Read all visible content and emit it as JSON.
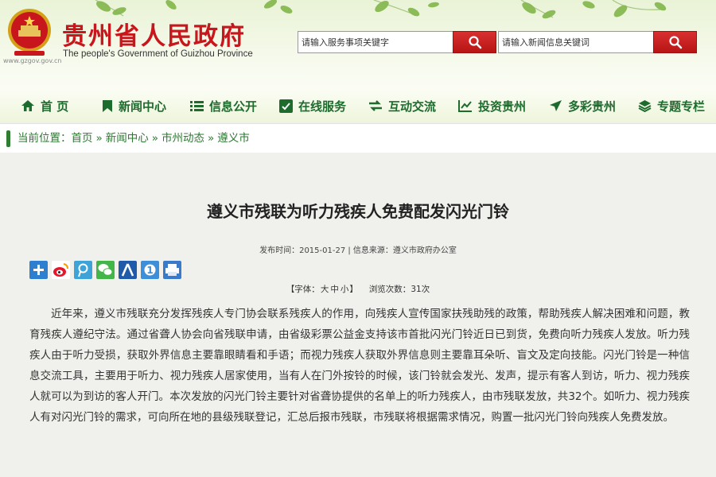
{
  "header": {
    "site_url": "www.gzgov.gov.cn",
    "title": "贵州省人民政府",
    "subtitle": "The people's Government of Guizhou Province",
    "service_search": {
      "placeholder": "请输入服务事项关键字"
    },
    "news_search": {
      "placeholder": "请输入新闻信息关键词"
    }
  },
  "nav": {
    "items": [
      {
        "label": "首 页",
        "icon": "home-icon"
      },
      {
        "label": "新闻中心",
        "icon": "bookmark-icon"
      },
      {
        "label": "信息公开",
        "icon": "list-icon"
      },
      {
        "label": "在线服务",
        "icon": "service-icon"
      },
      {
        "label": "互动交流",
        "icon": "exchange-icon"
      },
      {
        "label": "投资贵州",
        "icon": "chart-icon"
      },
      {
        "label": "多彩贵州",
        "icon": "plane-icon"
      },
      {
        "label": "专题专栏",
        "icon": "layers-icon"
      }
    ]
  },
  "breadcrumb": {
    "prefix": "当前位置：",
    "items": [
      "首页",
      "新闻中心",
      "市州动态",
      "遵义市"
    ],
    "separator": "»"
  },
  "article": {
    "title": "遵义市残联为听力残疾人免费配发闪光门铃",
    "meta": "发布时间：2015-01-27 | 信息来源：遵义市政府办公室",
    "share_icons": [
      "share-plus-icon",
      "weibo-icon",
      "tencent-weibo-icon",
      "wechat-icon",
      "renren-icon",
      "kaixin-icon",
      "print-icon"
    ],
    "font_label": "【字体：",
    "font_large": "大",
    "font_medium": "中",
    "font_small": "小",
    "font_close": "】",
    "views_label": "浏览次数：",
    "views_count": "31",
    "views_unit": "次",
    "body": "近年来，遵义市残联充分发挥残疾人专门协会联系残疾人的作用，向残疾人宣传国家扶残助残的政策，帮助残疾人解决困难和问题，教育残疾人遵纪守法。通过省聋人协会向省残联申请，由省级彩票公益金支持该市首批闪光门铃近日已到货，免费向听力残疾人发放。听力残疾人由于听力受损，获取外界信息主要靠眼睛看和手语；而视力残疾人获取外界信息则主要靠耳朵听、盲文及定向技能。闪光门铃是一种信息交流工具，主要用于听力、视力残疾人居家使用，当有人在门外按铃的时候，该门铃就会发光、发声，提示有客人到访，听力、视力残疾人就可以为到访的客人开门。本次发放的闪光门铃主要针对省聋协提供的名单上的听力残疾人，由市残联发放，共32个。如听力、视力残疾人有对闪光门铃的需求，可向所在地的县级残联登记，汇总后报市残联，市残联将根据需求情况，购置一批闪光门铃向残疾人免费发放。"
  },
  "colors": {
    "brand_red": "#c8161d",
    "nav_green": "#1e6b2e",
    "breadcrumb_green": "#2a7a2f",
    "search_button": "#c41a1a"
  }
}
